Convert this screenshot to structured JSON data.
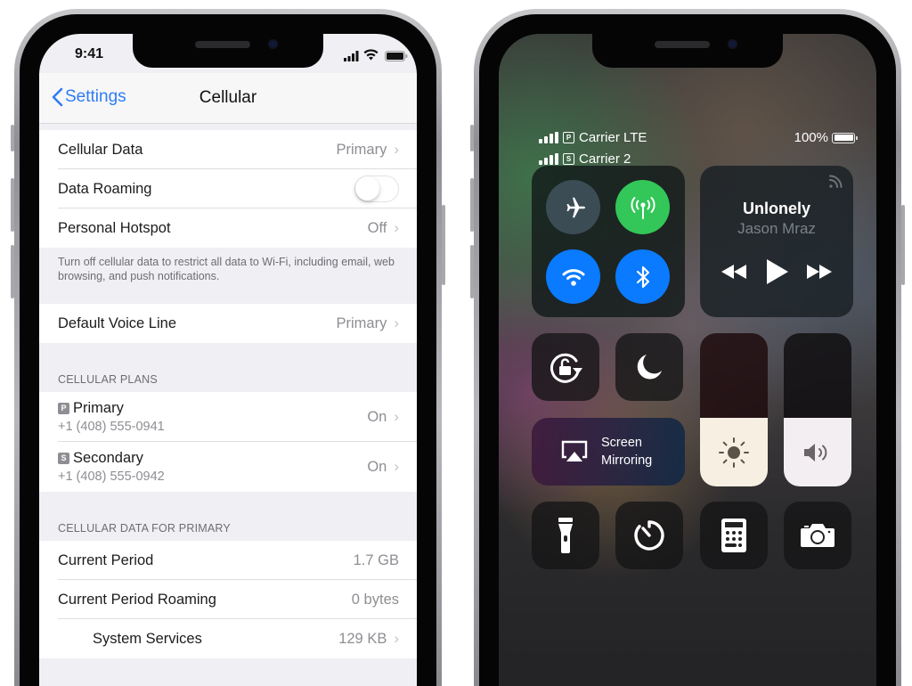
{
  "left_phone": {
    "status_bar": {
      "time": "9:41",
      "icons": [
        "cellular-signal-icon",
        "wifi-icon",
        "battery-icon"
      ]
    },
    "nav": {
      "back_label": "Settings",
      "title": "Cellular"
    },
    "group1": [
      {
        "label": "Cellular Data",
        "value": "Primary",
        "chevron": true
      },
      {
        "label": "Data Roaming",
        "toggle": false
      },
      {
        "label": "Personal Hotspot",
        "value": "Off",
        "chevron": true
      }
    ],
    "footnote": "Turn off cellular data to restrict all data to Wi-Fi, including email, web browsing, and push notifications.",
    "group2": [
      {
        "label": "Default Voice Line",
        "value": "Primary",
        "chevron": true
      }
    ],
    "plans_header": "CELLULAR PLANS",
    "plans": [
      {
        "badge": "P",
        "name": "Primary",
        "number": "+1 (408) 555-0941",
        "value": "On"
      },
      {
        "badge": "S",
        "name": "Secondary",
        "number": "+1 (408) 555-0942",
        "value": "On"
      }
    ],
    "usage_header": "CELLULAR DATA FOR PRIMARY",
    "usage": [
      {
        "label": "Current Period",
        "value": "1.7 GB"
      },
      {
        "label": "Current Period Roaming",
        "value": "0 bytes"
      },
      {
        "label": "System Services",
        "value": "129 KB",
        "chevron": true
      }
    ]
  },
  "right_phone": {
    "status": {
      "carrier1": {
        "badge": "P",
        "name": "Carrier LTE"
      },
      "carrier2": {
        "badge": "S",
        "name": "Carrier 2"
      },
      "battery": "100%"
    },
    "connectivity": {
      "airplane_mode": false,
      "cellular_data": true,
      "wifi": true,
      "bluetooth": true,
      "colors": {
        "airplane_off": "#3b4c55",
        "cellular_on": "#33c759",
        "wifi_on": "#0a7aff",
        "bluetooth_on": "#0a7aff"
      }
    },
    "now_playing": {
      "song": "Unlonely",
      "artist": "Jason Mraz"
    },
    "screen_mirroring": {
      "line1": "Screen",
      "line2": "Mirroring"
    },
    "brightness_level": 0.45,
    "volume_level": 0.45,
    "utilities": [
      "flashlight",
      "timer",
      "calculator",
      "camera"
    ]
  }
}
